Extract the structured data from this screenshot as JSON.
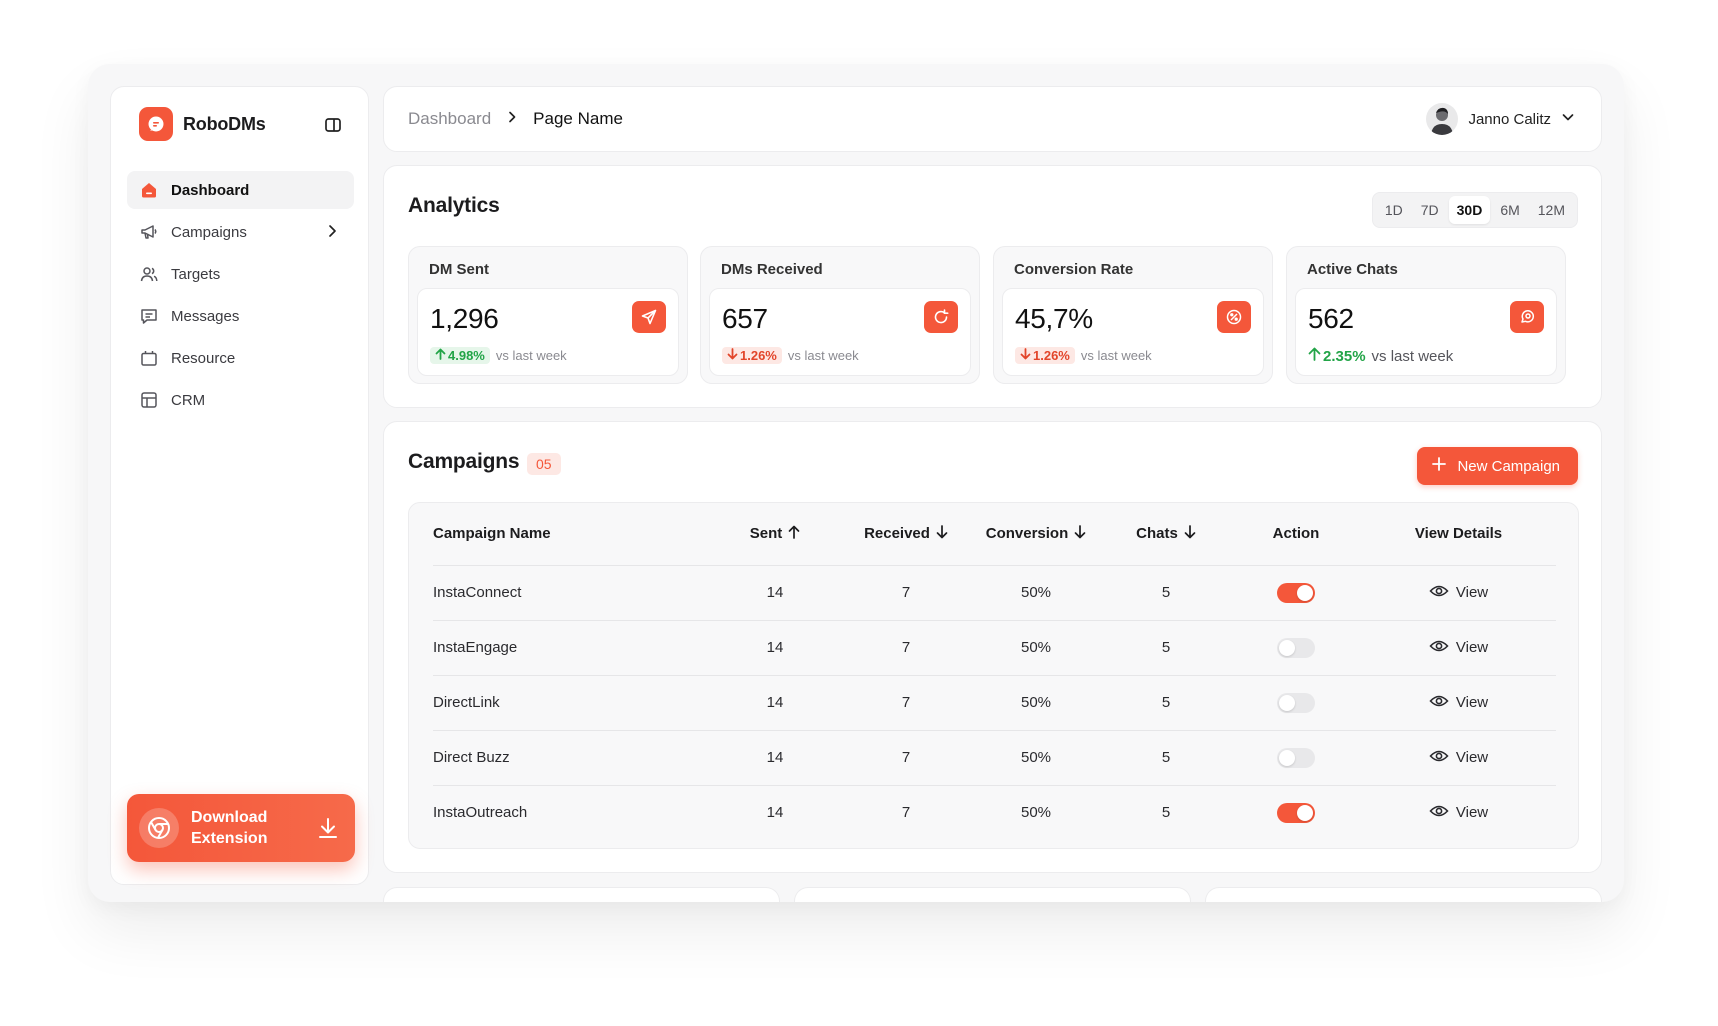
{
  "brand": {
    "name": "RoboDMs",
    "accent": "#f4573a"
  },
  "sidebar": {
    "items": [
      {
        "label": "Dashboard",
        "icon": "home-icon",
        "active": true
      },
      {
        "label": "Campaigns",
        "icon": "megaphone-icon",
        "has_submenu": true
      },
      {
        "label": "Targets",
        "icon": "users-icon"
      },
      {
        "label": "Messages",
        "icon": "message-icon"
      },
      {
        "label": "Resource",
        "icon": "folder-icon"
      },
      {
        "label": "CRM",
        "icon": "layout-icon"
      }
    ],
    "download": {
      "line1": "Download",
      "line2": "Extension",
      "icon": "chrome-icon"
    }
  },
  "header": {
    "breadcrumb_root": "Dashboard",
    "breadcrumb_current": "Page Name",
    "user_name": "Janno Calitz"
  },
  "analytics": {
    "title": "Analytics",
    "ranges": [
      "1D",
      "7D",
      "30D",
      "6M",
      "12M"
    ],
    "active_range": "30D",
    "stats": [
      {
        "label": "DM Sent",
        "value": "1,296",
        "change": "4.98%",
        "direction": "up",
        "suffix": "vs last week",
        "icon": "send-icon"
      },
      {
        "label": "DMs Received",
        "value": "657",
        "change": "1.26%",
        "direction": "down",
        "suffix": "vs last week",
        "icon": "refresh-icon"
      },
      {
        "label": "Conversion Rate",
        "value": "45,7%",
        "change": "1.26%",
        "direction": "down",
        "suffix": "vs last week",
        "icon": "percent-icon"
      },
      {
        "label": "Active Chats",
        "value": "562",
        "change": "2.35%",
        "direction": "up",
        "suffix": "vs last week",
        "icon": "chat-icon"
      }
    ]
  },
  "campaigns": {
    "title": "Campaigns",
    "count": "05",
    "new_button": "New Campaign",
    "columns": [
      "Campaign Name",
      "Sent",
      "Received",
      "Conversion",
      "Chats",
      "Action",
      "View Details"
    ],
    "view_label": "View",
    "rows": [
      {
        "name": "InstaConnect",
        "sent": "14",
        "received": "7",
        "conversion": "50%",
        "chats": "5",
        "active": true
      },
      {
        "name": "InstaEngage",
        "sent": "14",
        "received": "7",
        "conversion": "50%",
        "chats": "5",
        "active": false
      },
      {
        "name": "DirectLink",
        "sent": "14",
        "received": "7",
        "conversion": "50%",
        "chats": "5",
        "active": false
      },
      {
        "name": "Direct Buzz",
        "sent": "14",
        "received": "7",
        "conversion": "50%",
        "chats": "5",
        "active": false
      },
      {
        "name": "InstaOutreach",
        "sent": "14",
        "received": "7",
        "conversion": "50%",
        "chats": "5",
        "active": true
      }
    ]
  }
}
